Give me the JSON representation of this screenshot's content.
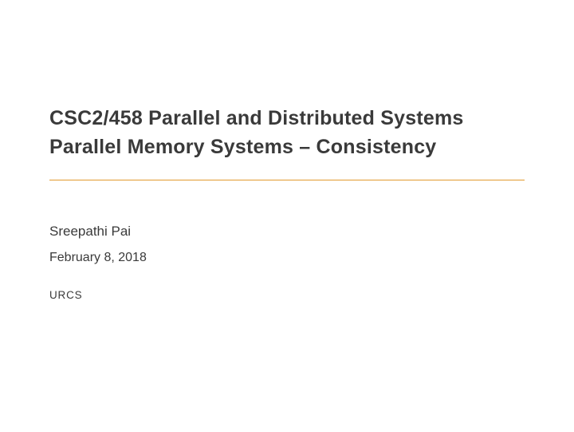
{
  "slide": {
    "title_line1": "CSC2/458 Parallel and Distributed Systems",
    "title_line2": "Parallel Memory Systems – Consistency",
    "author": "Sreepathi Pai",
    "date": "February 8, 2018",
    "affiliation": "URCS"
  }
}
